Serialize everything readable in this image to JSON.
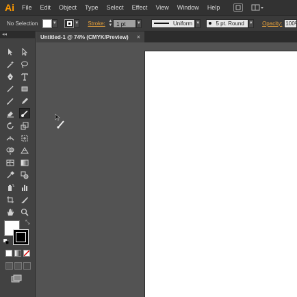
{
  "app": {
    "logo": "Ai"
  },
  "menu": [
    "File",
    "Edit",
    "Object",
    "Type",
    "Select",
    "Effect",
    "View",
    "Window",
    "Help"
  ],
  "menubar_right": [
    {
      "icon": "bridge-icon"
    },
    {
      "icon": "arrange-documents-icon"
    }
  ],
  "control": {
    "selection_label": "No Selection",
    "fill_color": "#ffffff",
    "stroke_label": "Stroke:",
    "stroke_weight": "1 pt",
    "variable_width_profile": "Uniform",
    "brush_definition": "5 pt. Round",
    "opacity_label": "Opacity:",
    "opacity_value": "100%"
  },
  "document": {
    "tab_title": "Untitled-1 @ 74% (CMYK/Preview)",
    "close_glyph": "×"
  },
  "tools_panel": {
    "collapse_glyph": "◂◂"
  },
  "colors": {
    "menubar": "#323232",
    "controlbar": "#3a3a3a",
    "panel": "#424242",
    "canvas": "#535353",
    "artboard": "#ffffff",
    "accent_label": "#e9a23b",
    "logo": "#ff9a00"
  }
}
